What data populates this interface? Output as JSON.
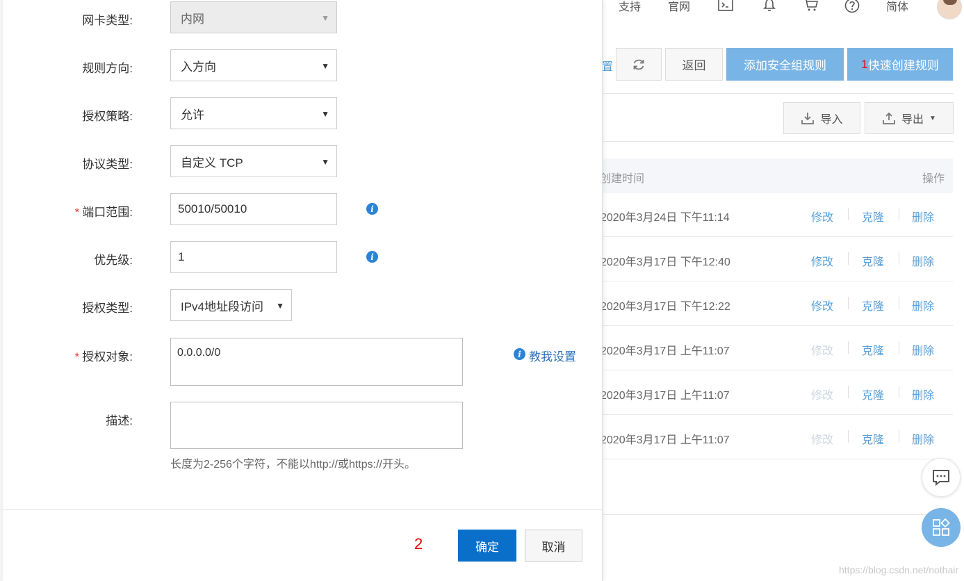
{
  "topnav": {
    "support": "支持",
    "official_site": "官网",
    "language": "简体",
    "icons": [
      "terminal-icon",
      "bell-icon",
      "cart-icon",
      "help-icon"
    ]
  },
  "toolbar": {
    "partial_link": "置",
    "back_label": "返回",
    "add_rule_label": "添加安全组规则",
    "quick_create_marker": "1",
    "quick_create_label": "快速创建规则"
  },
  "io": {
    "import_label": "导入",
    "export_label": "导出"
  },
  "table": {
    "col_created": "创建时间",
    "col_actions": "操作",
    "rows": [
      {
        "time": "2020年3月24日 下午11:14",
        "modify": "修改",
        "clone": "克隆",
        "delete": "删除",
        "modify_enabled": true
      },
      {
        "time": "2020年3月17日 下午12:40",
        "modify": "修改",
        "clone": "克隆",
        "delete": "删除",
        "modify_enabled": true
      },
      {
        "time": "2020年3月17日 下午12:22",
        "modify": "修改",
        "clone": "克隆",
        "delete": "删除",
        "modify_enabled": true
      },
      {
        "time": "2020年3月17日 上午11:07",
        "modify": "修改",
        "clone": "克隆",
        "delete": "删除",
        "modify_enabled": false
      },
      {
        "time": "2020年3月17日 上午11:07",
        "modify": "修改",
        "clone": "克隆",
        "delete": "删除",
        "modify_enabled": false
      },
      {
        "time": "2020年3月17日 上午11:07",
        "modify": "修改",
        "clone": "克隆",
        "delete": "删除",
        "modify_enabled": false
      }
    ]
  },
  "watermark": "https://blog.csdn.net/nothair",
  "form": {
    "nic_type": {
      "label": "网卡类型:",
      "value": "内网"
    },
    "direction": {
      "label": "规则方向:",
      "value": "入方向"
    },
    "policy": {
      "label": "授权策略:",
      "value": "允许"
    },
    "protocol": {
      "label": "协议类型:",
      "value": "自定义 TCP"
    },
    "port_range": {
      "label": "端口范围:",
      "value": "50010/50010",
      "required": true
    },
    "priority": {
      "label": "优先级:",
      "value": "1"
    },
    "auth_type": {
      "label": "授权类型:",
      "value": "IPv4地址段访问"
    },
    "auth_object": {
      "label": "授权对象:",
      "value": "0.0.0.0/0",
      "required": true
    },
    "description": {
      "label": "描述:",
      "value": ""
    },
    "help_link": "教我设置",
    "hint": "长度为2-256个字符，不能以http://或https://开头。",
    "info_glyph": "i",
    "required_mark": "*"
  },
  "footer": {
    "marker": "2",
    "ok_label": "确定",
    "cancel_label": "取消"
  },
  "colors": {
    "primary": "#0a6fc9",
    "primary_muted": "#79b4e6",
    "link": "#5a9fd6",
    "required": "#e03a3a",
    "annotation_red": "#ee0000"
  }
}
